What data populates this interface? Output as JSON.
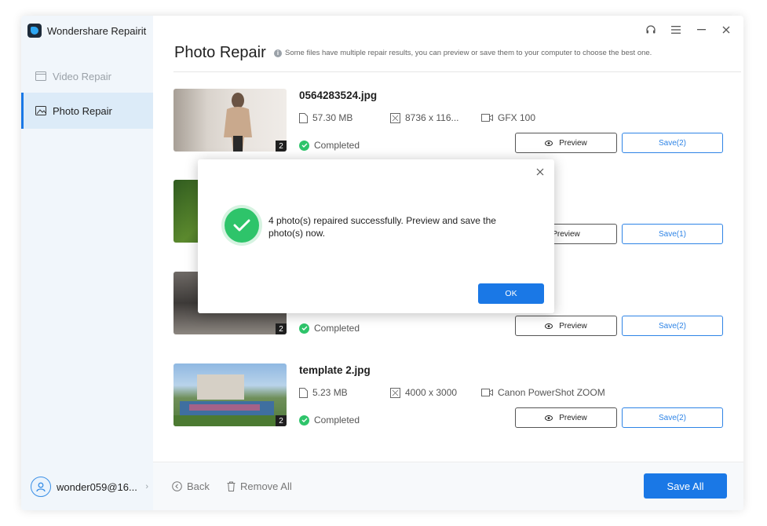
{
  "app": {
    "name": "Wondershare Repairit"
  },
  "sidebar": {
    "items": [
      {
        "label": "Video Repair",
        "active": false
      },
      {
        "label": "Photo Repair",
        "active": true
      }
    ],
    "user": "wonder059@16..."
  },
  "main": {
    "title": "Photo Repair",
    "hint": "Some files have multiple repair results, you can preview or save them to your computer to choose the best one."
  },
  "files": [
    {
      "name": "0564283524.jpg",
      "size": "57.30  MB",
      "resolution": "8736 x 116...",
      "camera": "GFX 100",
      "status": "Completed",
      "count": "2",
      "preview_label": "Preview",
      "save_label": "Save(2)"
    },
    {
      "name": "",
      "size": "",
      "resolution": "",
      "camera": "",
      "status": "",
      "count": "",
      "preview_label": "Preview",
      "save_label": "Save(1)"
    },
    {
      "name": "",
      "size": "",
      "resolution": "",
      "camera": "",
      "status": "Completed",
      "count": "2",
      "preview_label": "Preview",
      "save_label": "Save(2)"
    },
    {
      "name": "template 2.jpg",
      "size": "5.23  MB",
      "resolution": "4000 x 3000",
      "camera": "Canon PowerShot ZOOM",
      "status": "Completed",
      "count": "2",
      "preview_label": "Preview",
      "save_label": "Save(2)"
    }
  ],
  "footer": {
    "back": "Back",
    "remove_all": "Remove All",
    "save_all": "Save All"
  },
  "dialog": {
    "message": "4 photo(s) repaired successfully. Preview and save the photo(s) now.",
    "ok": "OK"
  },
  "colors": {
    "accent": "#1a78e6",
    "success": "#2ec46a",
    "sidebar_bg": "#f1f6fb"
  }
}
